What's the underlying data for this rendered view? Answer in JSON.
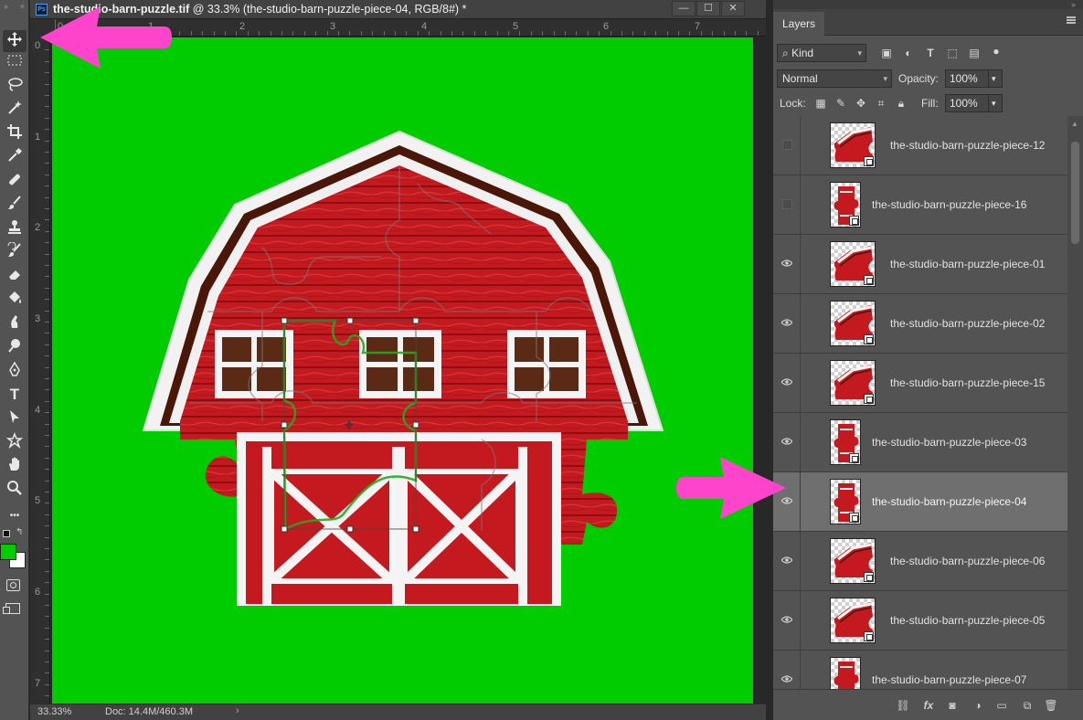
{
  "window": {
    "title_bold": "the-studio-barn-puzzle.tif",
    "title_rest": " @ 33.3% (the-studio-barn-puzzle-piece-04, RGB/8#) *",
    "min_label": "—",
    "restore_label": "☐",
    "close_label": "✕"
  },
  "tools": [
    {
      "name": "move-tool",
      "icon": "move-icon"
    },
    {
      "name": "marquee-tool",
      "icon": "rectangle-marquee-icon"
    },
    {
      "name": "lasso-tool",
      "icon": "lasso-icon"
    },
    {
      "name": "magic-wand-tool",
      "icon": "magic-wand-icon"
    },
    {
      "name": "crop-tool",
      "icon": "crop-icon"
    },
    {
      "name": "eyedropper-tool",
      "icon": "eyedropper-icon"
    },
    {
      "name": "healing-brush-tool",
      "icon": "bandage-icon"
    },
    {
      "name": "brush-tool",
      "icon": "brush-icon"
    },
    {
      "name": "clone-stamp-tool",
      "icon": "stamp-icon"
    },
    {
      "name": "history-brush-tool",
      "icon": "history-brush-icon"
    },
    {
      "name": "eraser-tool",
      "icon": "eraser-icon"
    },
    {
      "name": "paint-bucket-tool",
      "icon": "paint-bucket-icon"
    },
    {
      "name": "smudge-tool",
      "icon": "smudge-icon"
    },
    {
      "name": "dodge-tool",
      "icon": "dodge-icon"
    },
    {
      "name": "pen-tool",
      "icon": "pen-icon"
    },
    {
      "name": "type-tool",
      "icon": "type-icon"
    },
    {
      "name": "path-selection-tool",
      "icon": "arrow-select-icon"
    },
    {
      "name": "custom-shape-tool",
      "icon": "shape-icon"
    },
    {
      "name": "hand-tool",
      "icon": "hand-icon"
    },
    {
      "name": "zoom-tool",
      "icon": "zoom-icon"
    },
    {
      "name": "more-tools",
      "icon": "ellipsis-icon"
    }
  ],
  "type_tool_glyph": "T",
  "more_glyph": "•••",
  "colors": {
    "foreground": "#00cc00",
    "background": "#ffffff",
    "canvas_bg": "#00cc00",
    "annotation_arrow": "#ff44cc",
    "selected_layer": "#6f6f6f"
  },
  "rulers": {
    "horizontal_labels": [
      "0",
      "1",
      "2",
      "3",
      "4",
      "5",
      "6",
      "7"
    ],
    "vertical_labels": [
      "0",
      "1",
      "2",
      "3",
      "4",
      "5",
      "6",
      "7"
    ]
  },
  "status": {
    "zoom": "33.33%",
    "doc": "Doc: 14.4M/460.3M",
    "arrow": "›"
  },
  "layers_panel": {
    "tab_label": "Layers",
    "filter_kind": "Kind",
    "blend_mode": "Normal",
    "opacity_label": "Opacity:",
    "opacity_value": "100%",
    "lock_label": "Lock:",
    "fill_label": "Fill:",
    "fill_value": "100%",
    "filter_type_glyph": "T",
    "layers": [
      {
        "name": "the-studio-barn-puzzle-piece-12",
        "visible": false,
        "selected": false,
        "thumb": "wide"
      },
      {
        "name": "the-studio-barn-puzzle-piece-16",
        "visible": false,
        "selected": false,
        "thumb": "tall"
      },
      {
        "name": "the-studio-barn-puzzle-piece-01",
        "visible": true,
        "selected": false,
        "thumb": "wide"
      },
      {
        "name": "the-studio-barn-puzzle-piece-02",
        "visible": true,
        "selected": false,
        "thumb": "wide"
      },
      {
        "name": "the-studio-barn-puzzle-piece-15",
        "visible": true,
        "selected": false,
        "thumb": "wide"
      },
      {
        "name": "the-studio-barn-puzzle-piece-03",
        "visible": true,
        "selected": false,
        "thumb": "tall"
      },
      {
        "name": "the-studio-barn-puzzle-piece-04",
        "visible": true,
        "selected": true,
        "thumb": "tall"
      },
      {
        "name": "the-studio-barn-puzzle-piece-06",
        "visible": true,
        "selected": false,
        "thumb": "wide"
      },
      {
        "name": "the-studio-barn-puzzle-piece-05",
        "visible": true,
        "selected": false,
        "thumb": "wide"
      },
      {
        "name": "the-studio-barn-puzzle-piece-07",
        "visible": true,
        "selected": false,
        "thumb": "tall"
      }
    ],
    "footer_icons": [
      "link-icon",
      "fx-icon",
      "mask-icon",
      "adjustment-icon",
      "folder-icon",
      "new-layer-icon",
      "trash-icon"
    ],
    "footer_fx": "fx"
  }
}
